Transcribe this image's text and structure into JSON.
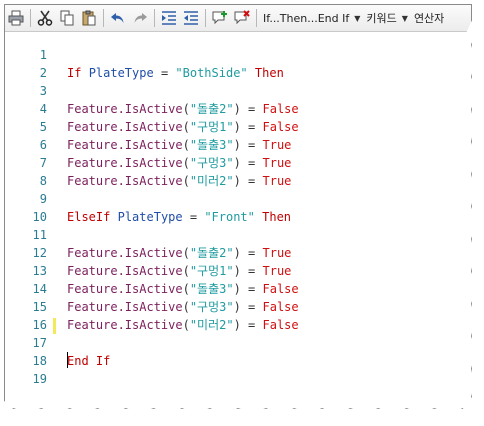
{
  "toolbar": {
    "buttons": [
      {
        "name": "print-icon"
      },
      {
        "name": "cut-icon"
      },
      {
        "name": "copy-icon"
      },
      {
        "name": "paste-icon"
      },
      {
        "name": "undo-icon"
      },
      {
        "name": "redo-icon"
      },
      {
        "name": "indent-icon"
      },
      {
        "name": "outdent-icon"
      },
      {
        "name": "add-comment-icon"
      },
      {
        "name": "remove-comment-icon"
      }
    ],
    "snippet_label": "If...Then...End If",
    "keyword_label": "키워드",
    "operator_label": "연산자"
  },
  "editor": {
    "lines": [
      {
        "num": "1",
        "tokens": []
      },
      {
        "num": "2",
        "tokens": [
          {
            "t": "If",
            "c": "ctl"
          },
          {
            "t": " ",
            "c": "op"
          },
          {
            "t": "PlateType",
            "c": "id"
          },
          {
            "t": " = ",
            "c": "op"
          },
          {
            "t": "\"BothSide\"",
            "c": "str"
          },
          {
            "t": " ",
            "c": "op"
          },
          {
            "t": "Then",
            "c": "ctl"
          }
        ]
      },
      {
        "num": "3",
        "tokens": []
      },
      {
        "num": "4",
        "tokens": [
          {
            "t": "Feature.IsActive",
            "c": "obj"
          },
          {
            "t": "(",
            "c": "op"
          },
          {
            "t": "\"돌출2\"",
            "c": "str"
          },
          {
            "t": ") = ",
            "c": "op"
          },
          {
            "t": "False",
            "c": "bool"
          }
        ]
      },
      {
        "num": "5",
        "tokens": [
          {
            "t": "Feature.IsActive",
            "c": "obj"
          },
          {
            "t": "(",
            "c": "op"
          },
          {
            "t": "\"구멍1\"",
            "c": "str"
          },
          {
            "t": ") = ",
            "c": "op"
          },
          {
            "t": "False",
            "c": "bool"
          }
        ]
      },
      {
        "num": "6",
        "tokens": [
          {
            "t": "Feature.IsActive",
            "c": "obj"
          },
          {
            "t": "(",
            "c": "op"
          },
          {
            "t": "\"돌출3\"",
            "c": "str"
          },
          {
            "t": ") = ",
            "c": "op"
          },
          {
            "t": "True",
            "c": "bool"
          }
        ]
      },
      {
        "num": "7",
        "tokens": [
          {
            "t": "Feature.IsActive",
            "c": "obj"
          },
          {
            "t": "(",
            "c": "op"
          },
          {
            "t": "\"구멍3\"",
            "c": "str"
          },
          {
            "t": ") = ",
            "c": "op"
          },
          {
            "t": "True",
            "c": "bool"
          }
        ]
      },
      {
        "num": "8",
        "tokens": [
          {
            "t": "Feature.IsActive",
            "c": "obj"
          },
          {
            "t": "(",
            "c": "op"
          },
          {
            "t": "\"미러2\"",
            "c": "str"
          },
          {
            "t": ") = ",
            "c": "op"
          },
          {
            "t": "True",
            "c": "bool"
          }
        ]
      },
      {
        "num": "9",
        "tokens": []
      },
      {
        "num": "10",
        "tokens": [
          {
            "t": "ElseIf",
            "c": "ctl"
          },
          {
            "t": " ",
            "c": "op"
          },
          {
            "t": "PlateType",
            "c": "id"
          },
          {
            "t": " = ",
            "c": "op"
          },
          {
            "t": "\"Front\"",
            "c": "str"
          },
          {
            "t": " ",
            "c": "op"
          },
          {
            "t": "Then",
            "c": "ctl"
          }
        ]
      },
      {
        "num": "11",
        "tokens": []
      },
      {
        "num": "12",
        "tokens": [
          {
            "t": "Feature.IsActive",
            "c": "obj"
          },
          {
            "t": "(",
            "c": "op"
          },
          {
            "t": "\"돌출2\"",
            "c": "str"
          },
          {
            "t": ") = ",
            "c": "op"
          },
          {
            "t": "True",
            "c": "bool"
          }
        ]
      },
      {
        "num": "13",
        "tokens": [
          {
            "t": "Feature.IsActive",
            "c": "obj"
          },
          {
            "t": "(",
            "c": "op"
          },
          {
            "t": "\"구멍1\"",
            "c": "str"
          },
          {
            "t": ") = ",
            "c": "op"
          },
          {
            "t": "True",
            "c": "bool"
          }
        ]
      },
      {
        "num": "14",
        "tokens": [
          {
            "t": "Feature.IsActive",
            "c": "obj"
          },
          {
            "t": "(",
            "c": "op"
          },
          {
            "t": "\"돌출3\"",
            "c": "str"
          },
          {
            "t": ") = ",
            "c": "op"
          },
          {
            "t": "False",
            "c": "bool"
          }
        ]
      },
      {
        "num": "15",
        "tokens": [
          {
            "t": "Feature.IsActive",
            "c": "obj"
          },
          {
            "t": "(",
            "c": "op"
          },
          {
            "t": "\"구멍3\"",
            "c": "str"
          },
          {
            "t": ") = ",
            "c": "op"
          },
          {
            "t": "False",
            "c": "bool"
          }
        ]
      },
      {
        "num": "16",
        "tokens": [
          {
            "t": "Feature.IsActive",
            "c": "obj"
          },
          {
            "t": "(",
            "c": "op"
          },
          {
            "t": "\"미러2\"",
            "c": "str"
          },
          {
            "t": ") = ",
            "c": "op"
          },
          {
            "t": "False",
            "c": "bool"
          }
        ]
      },
      {
        "num": "17",
        "tokens": []
      },
      {
        "num": "18",
        "tokens": [
          {
            "t": "End If",
            "c": "ctl"
          }
        ]
      },
      {
        "num": "19",
        "tokens": []
      }
    ]
  },
  "colors": {
    "line_number": "#2b7c91",
    "control_keyword": "#c00000",
    "identifier": "#1f4ea8",
    "object_call": "#7b1f5c",
    "string": "#1f9ba0",
    "boolean": "#d01010",
    "change_marker": "#f2ea5a"
  }
}
